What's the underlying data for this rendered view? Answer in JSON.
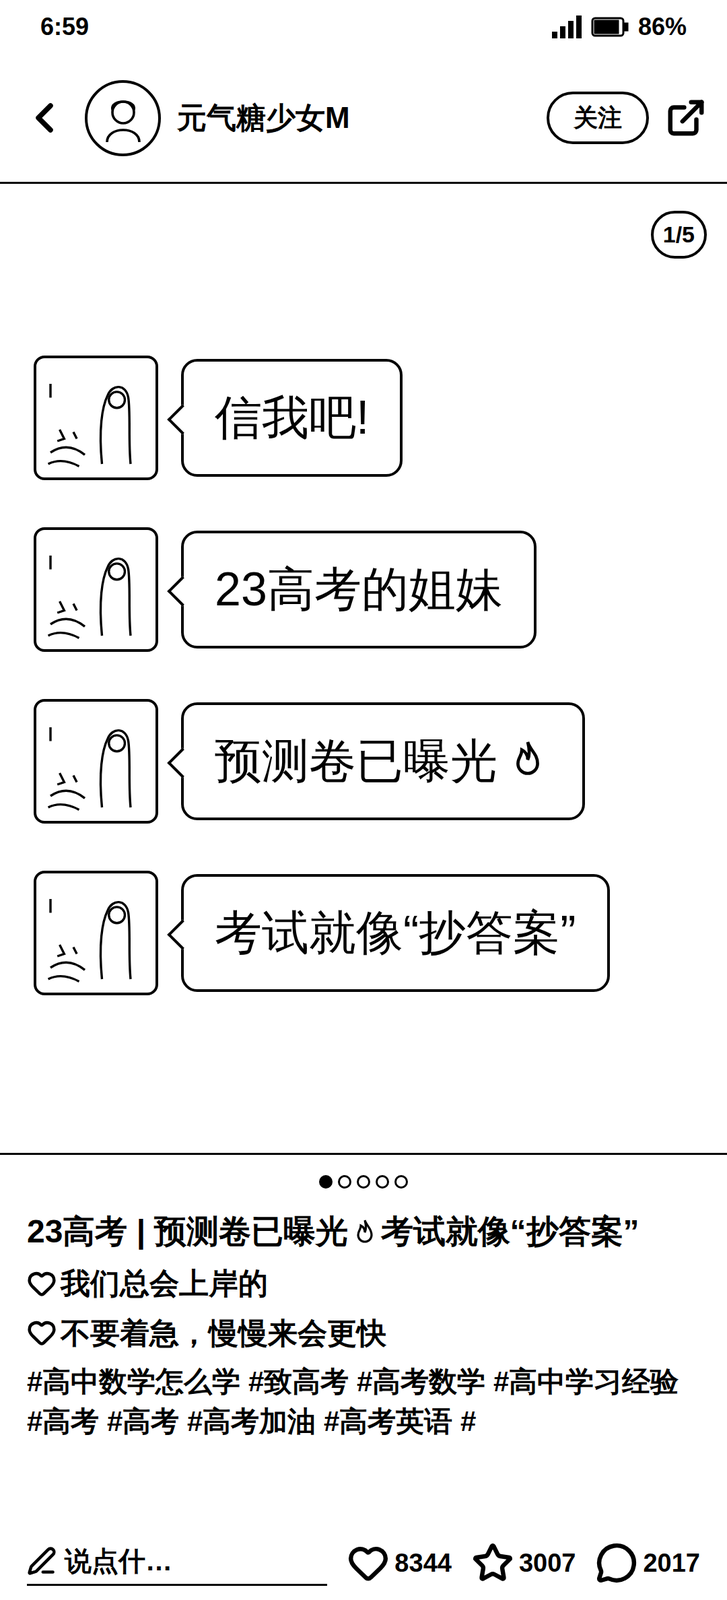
{
  "status_bar": {
    "time": "6:59",
    "battery": "86%"
  },
  "author": {
    "name": "元气糖少女M",
    "follow_button": "关注"
  },
  "image": {
    "page_indicator": "1/5",
    "messages": [
      {
        "text": "信我吧!",
        "trailing_icon": false
      },
      {
        "text": "23高考的姐妹",
        "trailing_icon": false
      },
      {
        "text": "预测卷已曝光",
        "trailing_icon": true
      },
      {
        "text": "考试就像“抄答案”",
        "trailing_icon": false
      }
    ]
  },
  "carousel_dots": [
    {
      "selected": true
    },
    {
      "selected": false
    },
    {
      "selected": false
    },
    {
      "selected": false
    },
    {
      "selected": false
    }
  ],
  "post": {
    "title_before_icon": "23高考 | 预测卷已曝光",
    "title_after_icon": "考试就像“抄答案”",
    "lines": [
      "我们总会上岸的",
      "不要着急，慢慢来会更快"
    ],
    "tags": "#高中数学怎么学 #致高考 #高考数学 #高中学习经验 #高考 #高考 #高考加油 #高考英语 #"
  },
  "actions": {
    "comment_placeholder": "说点什…",
    "likes": "8344",
    "favorites": "3007",
    "comments": "2017"
  }
}
